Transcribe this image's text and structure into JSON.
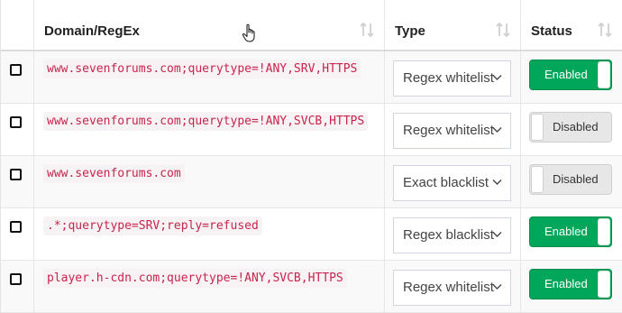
{
  "header": {
    "domain": "Domain/RegEx",
    "type": "Type",
    "status": "Status"
  },
  "colors": {
    "enabled": "#00a65a",
    "disabled": "#e7e7e7",
    "code_text": "#c7254e"
  },
  "rows": [
    {
      "domain": "www.sevenforums.com;querytype=!ANY,SRV,HTTPS",
      "type": "Regex whitelist",
      "status": "Enabled",
      "enabled": true
    },
    {
      "domain": "www.sevenforums.com;querytype=!ANY,SVCB,HTTPS",
      "type": "Regex whitelist",
      "status": "Disabled",
      "enabled": false
    },
    {
      "domain": "www.sevenforums.com",
      "type": "Exact blacklist",
      "status": "Disabled",
      "enabled": false
    },
    {
      "domain": ".*;querytype=SRV;reply=refused",
      "type": "Regex blacklist",
      "status": "Enabled",
      "enabled": true
    },
    {
      "domain": "player.h-cdn.com;querytype=!ANY,SVCB,HTTPS",
      "type": "Regex whitelist",
      "status": "Enabled",
      "enabled": true
    }
  ]
}
